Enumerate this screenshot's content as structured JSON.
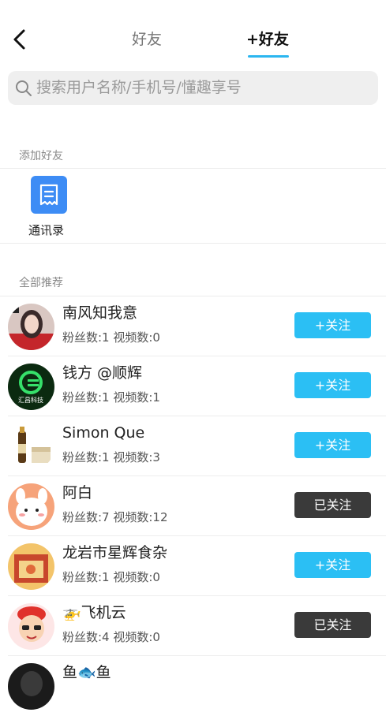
{
  "header": {
    "tab_friends": "好友",
    "tab_add_friends": "+好友"
  },
  "search": {
    "placeholder": "搜索用户名称/手机号/懂趣享号"
  },
  "add_friends": {
    "title": "添加好友",
    "contacts_label": "通讯录"
  },
  "recommend": {
    "title": "全部推荐",
    "users": [
      {
        "name": "南风知我意",
        "stats": "粉丝数:1  视频数:0",
        "button": "+关注",
        "followed": false
      },
      {
        "name": "钱方 @顺辉",
        "stats": "粉丝数:1  视频数:1",
        "button": "+关注",
        "followed": false
      },
      {
        "name": "Simon Que",
        "stats": "粉丝数:1  视频数:3",
        "button": "+关注",
        "followed": false
      },
      {
        "name": "阿白",
        "stats": "粉丝数:7  视频数:12",
        "button": "已关注",
        "followed": true
      },
      {
        "name": "龙岩市星辉食杂",
        "stats": "粉丝数:1  视频数:0",
        "button": "+关注",
        "followed": false
      },
      {
        "name": "🚁飞机云",
        "stats": "粉丝数:4  视频数:0",
        "button": "已关注",
        "followed": true
      },
      {
        "name": "鱼🐟鱼",
        "stats": "",
        "button": "",
        "followed": false
      }
    ]
  },
  "colors": {
    "accent": "#2bbff4",
    "followed": "#3a3a3a",
    "contacts_icon": "#3d8cf5"
  },
  "icons": {
    "back": "chevron-left-icon",
    "search": "search-icon",
    "contacts": "contacts-book-icon"
  }
}
